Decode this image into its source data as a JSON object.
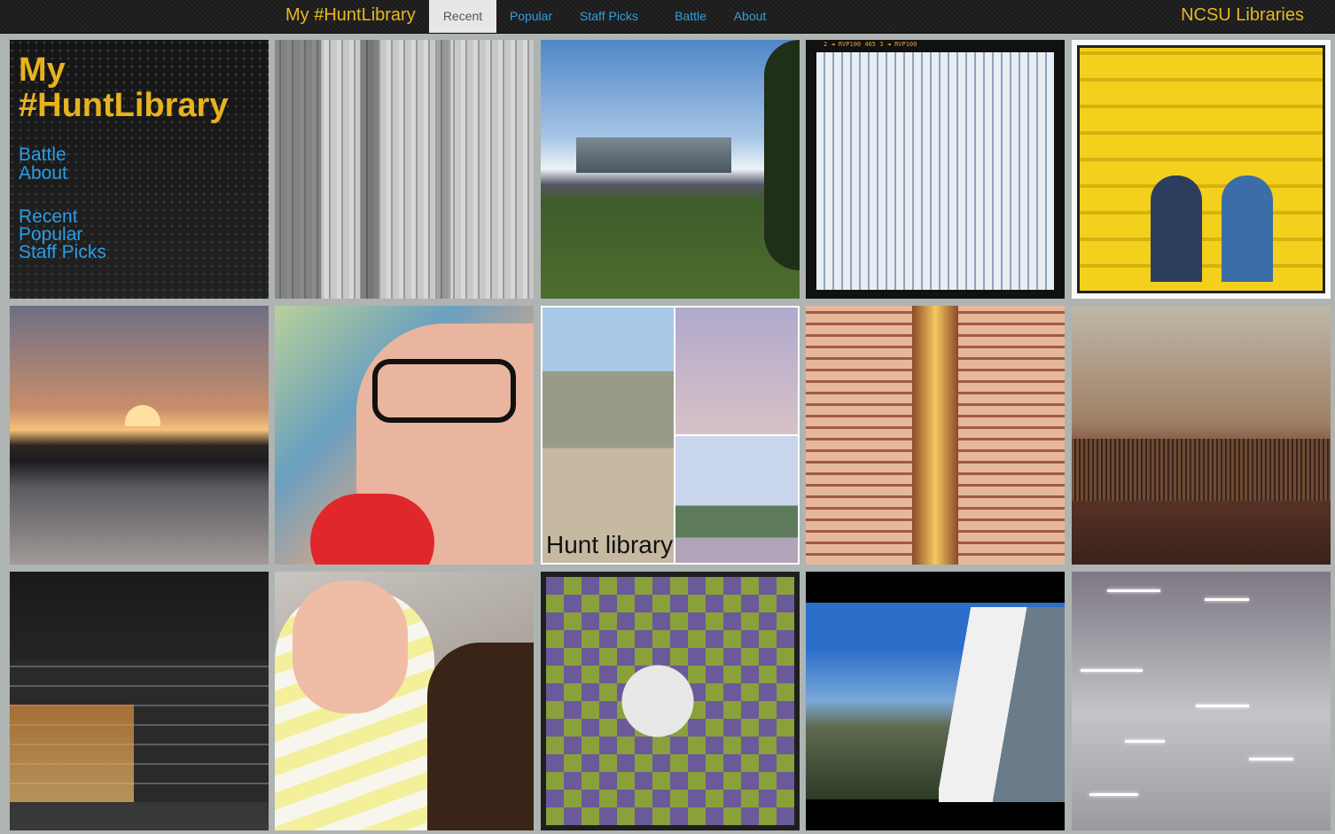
{
  "header": {
    "brand": "My #HuntLibrary",
    "nav": [
      "Recent",
      "Popular",
      "Staff Picks",
      "Battle",
      "About"
    ],
    "active": "Recent",
    "org": "NCSU Libraries"
  },
  "intro": {
    "title_line1": "My",
    "title_line2": "#HuntLibrary",
    "links": [
      "Battle",
      "About",
      "Recent",
      "Popular",
      "Staff Picks"
    ]
  },
  "photos": {
    "collage_caption": "Hunt library",
    "film_markers": "2  ◄ RVP100          465  3  ◄ RVP100"
  },
  "colors": {
    "accent_gold": "#e6b31e",
    "link_blue": "#2a9de8",
    "bar_bg": "#1b1b1b",
    "active_tab_bg": "#e7e7e7"
  }
}
